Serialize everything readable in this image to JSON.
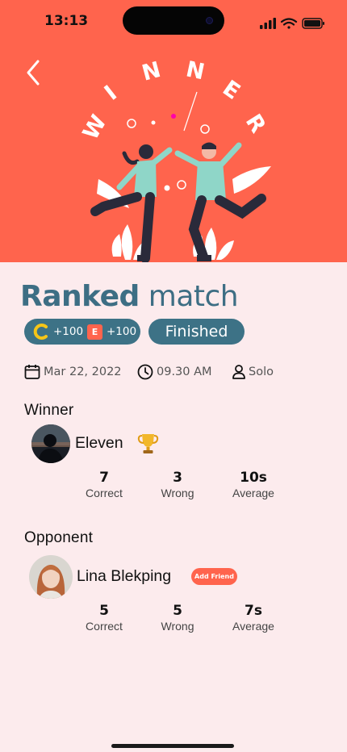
{
  "status_bar": {
    "time": "13:13"
  },
  "hero": {
    "banner_letters": [
      "W",
      "I",
      "N",
      "N",
      "E",
      "R"
    ],
    "background_color": "#ff644d",
    "back_icon": "chevron-left-icon"
  },
  "match": {
    "title_bold": "Ranked",
    "title_light": "match",
    "rewards": {
      "coin_gain": "+100",
      "xp_badge": "E",
      "xp_gain": "+100"
    },
    "status": "Finished",
    "date": "Mar 22, 2022",
    "time": "09.30 AM",
    "mode": "Solo"
  },
  "winner": {
    "heading": "Winner",
    "name": "Eleven",
    "trophy_icon": "trophy-icon",
    "stats": [
      {
        "value": "7",
        "label": "Correct"
      },
      {
        "value": "3",
        "label": "Wrong"
      },
      {
        "value": "10s",
        "label": "Average"
      }
    ]
  },
  "opponent": {
    "heading": "Opponent",
    "name": "Lina Blekping",
    "add_friend_label": "Add Friend",
    "stats": [
      {
        "value": "5",
        "label": "Correct"
      },
      {
        "value": "5",
        "label": "Wrong"
      },
      {
        "value": "7s",
        "label": "Average"
      }
    ]
  },
  "colors": {
    "accent": "#ff644d",
    "primary": "#3d7286",
    "background": "#fcebed"
  }
}
